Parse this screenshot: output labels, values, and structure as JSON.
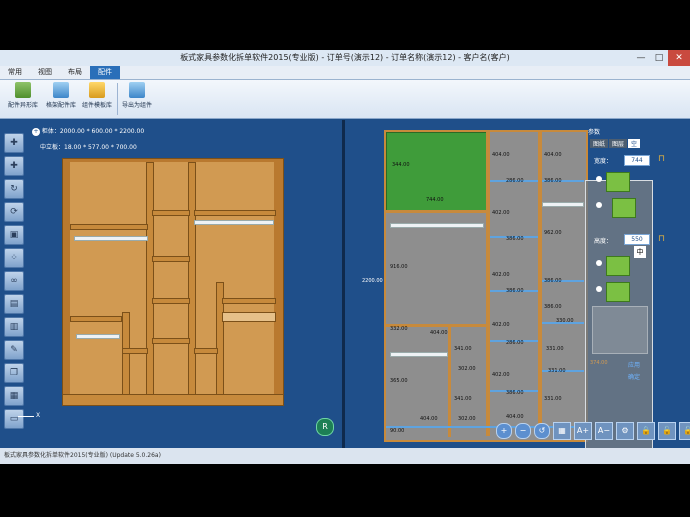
{
  "window": {
    "title": "板式家具参数化拆单软件2015(专业版) - 订单号(演示12) - 订单名称(演示12) - 客户名(客户)",
    "minimize": "—",
    "maximize": "□",
    "close": "✕"
  },
  "tabs": [
    {
      "label": "常用"
    },
    {
      "label": "视图"
    },
    {
      "label": "布局"
    },
    {
      "label": "配件"
    }
  ],
  "ribbon": {
    "buttons": [
      {
        "label": "配件异形库"
      },
      {
        "label": "格架配件库"
      },
      {
        "label": "组件模板库"
      },
      {
        "label": "导出为组件"
      }
    ]
  },
  "left": {
    "cabinet_label": "柜体：2000.00 * 600.00 * 2200.00",
    "board_label": "中立板：18.00 * 577.00 * 700.00",
    "axis_x": "X",
    "axis_r": "R"
  },
  "right": {
    "dims": {
      "d344": "344.00",
      "d744": "744.00",
      "d916": "916.00",
      "d404a": "404.00",
      "d404b": "404.00",
      "d286a": "286.00",
      "d386a": "386.00",
      "d402": "402.00",
      "d386b": "386.00",
      "d402b": "402.00",
      "d386c": "386.00",
      "d386d": "386.00",
      "d402c": "402.00",
      "d286b": "286.00",
      "d402d": "402.00",
      "d962": "962.00",
      "d386e": "386.00",
      "d386f": "386.00",
      "d331": "331.00",
      "d330": "330.00",
      "d332": "332.00",
      "d302": "302.00",
      "d341": "341.00",
      "d365": "365.00",
      "d404c": "404.00",
      "d404d": "404.00",
      "d404e": "404.00",
      "d331b": "331.00",
      "d90": "90.00",
      "d2200": "2200.00",
      "d331c": "331.00",
      "d341b": "341.00",
      "d302b": "302.00"
    },
    "param": {
      "title": "参数",
      "tab1": "图纸",
      "tab2": "图层",
      "tab3": "空",
      "width_label": "宽度：",
      "width_value": "744",
      "height_label": "高度：",
      "height_value": "550",
      "center_label": "中",
      "action1": "应用",
      "action2": "确定",
      "code": "374.00"
    },
    "toolbar": [
      "+",
      "−",
      "↺",
      "▦",
      "A+",
      "A−",
      "⚙",
      "🔒",
      "🔓",
      "🔓"
    ]
  },
  "status": {
    "text": "板式家具参数化拆单软件2015(专业版) (Update 5.0.26a)"
  },
  "colors": {
    "panel_bg": "#1f4f8a",
    "wood": "#c78a3c",
    "selected": "#3f9c3a",
    "accent_tab": "#2a6fb9"
  }
}
